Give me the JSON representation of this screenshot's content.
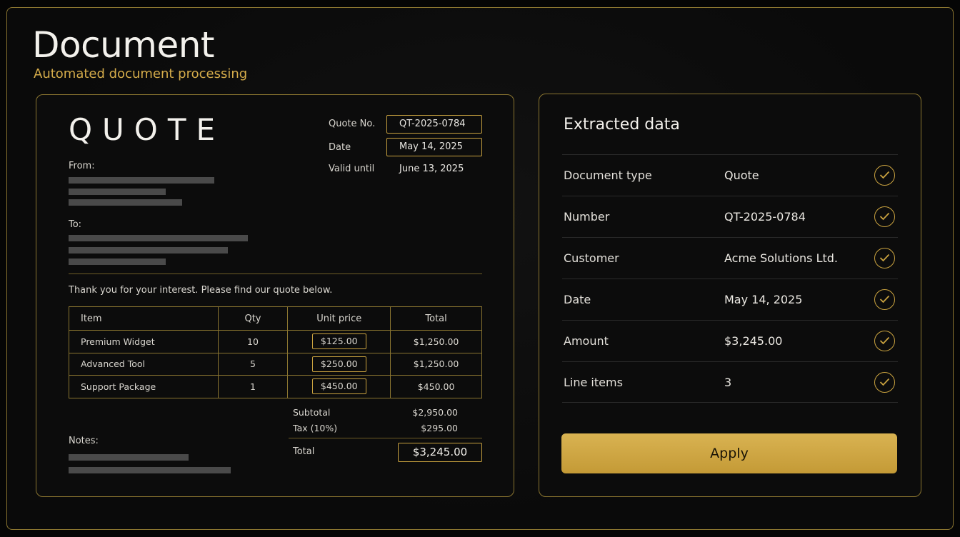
{
  "header": {
    "title": "Document",
    "subtitle": "Automated document processing"
  },
  "document": {
    "heading": "QUOTE",
    "meta": {
      "quote_no_label": "Quote No.",
      "quote_no": "QT-2025-0784",
      "date_label": "Date",
      "date": "May 14, 2025",
      "valid_label": "Valid until",
      "valid": "June 13, 2025"
    },
    "from_label": "From:",
    "to_label": "To:",
    "intro": "Thank you for your interest. Please find our quote below.",
    "table": {
      "headers": [
        "Item",
        "Qty",
        "Unit price",
        "Total"
      ],
      "rows": [
        {
          "item": "Premium Widget",
          "qty": "10",
          "unit": "$125.00",
          "total": "$1,250.00"
        },
        {
          "item": "Advanced Tool",
          "qty": "5",
          "unit": "$250.00",
          "total": "$1,250.00"
        },
        {
          "item": "Support Package",
          "qty": "1",
          "unit": "$450.00",
          "total": "$450.00"
        }
      ]
    },
    "summary": {
      "subtotal_label": "Subtotal",
      "subtotal": "$2,950.00",
      "tax_label": "Tax (10%)",
      "tax": "$295.00",
      "total_label": "Total",
      "total": "$3,245.00"
    },
    "notes_label": "Notes:"
  },
  "extracted": {
    "title": "Extracted data",
    "fields": [
      {
        "label": "Document type",
        "value": "Quote",
        "status": "check-circle-icon"
      },
      {
        "label": "Number",
        "value": "QT-2025-0784",
        "status": "check-circle-icon"
      },
      {
        "label": "Customer",
        "value": "Acme Solutions Ltd.",
        "status": "check-circle-icon"
      },
      {
        "label": "Date",
        "value": "May 14, 2025",
        "status": "check-circle-icon"
      },
      {
        "label": "Amount",
        "value": "$3,245.00",
        "status": "check-circle-icon"
      },
      {
        "label": "Line items",
        "value": "3",
        "status": "check-circle-icon"
      }
    ],
    "apply_label": "Apply"
  },
  "colors": {
    "accent": "#c9a23f",
    "background": "#0a0a0a",
    "button": "#d4ad4a"
  }
}
